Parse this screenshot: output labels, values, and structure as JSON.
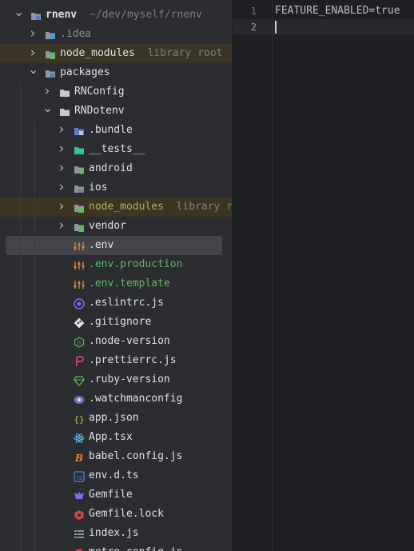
{
  "project": {
    "name": "rnenv",
    "path": "~/dev/myself/rnenv"
  },
  "tree": [
    {
      "label": "rnenv",
      "hint": "~/dev/myself/rnenv",
      "icon": "module-folder-icon",
      "chevron": "down",
      "color": "#dfe1e5"
    },
    {
      "label": ".idea",
      "hint": "",
      "icon": "idea-folder-icon",
      "chevron": "right",
      "color": "#8c8f95"
    },
    {
      "label": "node_modules",
      "hint": "library root",
      "icon": "node-modules-folder-icon",
      "chevron": "right",
      "color": "#dfe1e5"
    },
    {
      "label": "packages",
      "hint": "",
      "icon": "module-folder-icon",
      "chevron": "down",
      "color": "#dfe1e5"
    },
    {
      "label": "RNConfig",
      "hint": "",
      "icon": "folder-icon",
      "chevron": "right",
      "color": "#dfe1e5"
    },
    {
      "label": "RNDotenv",
      "hint": "",
      "icon": "folder-icon",
      "chevron": "down",
      "color": "#dfe1e5"
    },
    {
      "label": ".bundle",
      "hint": "",
      "icon": "config-folder-icon",
      "chevron": "right",
      "color": "#dfe1e5"
    },
    {
      "label": "__tests__",
      "hint": "",
      "icon": "tests-folder-icon",
      "chevron": "right",
      "color": "#dfe1e5"
    },
    {
      "label": "android",
      "hint": "",
      "icon": "android-folder-icon",
      "chevron": "right",
      "color": "#dfe1e5"
    },
    {
      "label": "ios",
      "hint": "",
      "icon": "ios-folder-icon",
      "chevron": "right",
      "color": "#dfe1e5"
    },
    {
      "label": "node_modules",
      "hint": "library roo",
      "icon": "node-modules-folder-icon",
      "chevron": "right",
      "color": "#b3ae60"
    },
    {
      "label": "vendor",
      "hint": "",
      "icon": "vendor-folder-icon",
      "chevron": "right",
      "color": "#dfe1e5"
    },
    {
      "label": ".env",
      "hint": "",
      "icon": "env-file-icon",
      "chevron": "",
      "color": "#dfe1e5"
    },
    {
      "label": ".env.production",
      "hint": "",
      "icon": "env-file-icon",
      "chevron": "",
      "color": "#5fb863"
    },
    {
      "label": ".env.template",
      "hint": "",
      "icon": "env-file-icon",
      "chevron": "",
      "color": "#5fb863"
    },
    {
      "label": ".eslintrc.js",
      "hint": "",
      "icon": "eslint-icon",
      "chevron": "",
      "color": "#dfe1e5"
    },
    {
      "label": ".gitignore",
      "hint": "",
      "icon": "git-icon",
      "chevron": "",
      "color": "#dfe1e5"
    },
    {
      "label": ".node-version",
      "hint": "",
      "icon": "nodejs-icon",
      "chevron": "",
      "color": "#dfe1e5"
    },
    {
      "label": ".prettierrc.js",
      "hint": "",
      "icon": "prettier-icon",
      "chevron": "",
      "color": "#dfe1e5"
    },
    {
      "label": ".ruby-version",
      "hint": "",
      "icon": "ruby-icon",
      "chevron": "",
      "color": "#dfe1e5"
    },
    {
      "label": ".watchmanconfig",
      "hint": "",
      "icon": "watchman-icon",
      "chevron": "",
      "color": "#dfe1e5"
    },
    {
      "label": "app.json",
      "hint": "",
      "icon": "json-icon",
      "chevron": "",
      "color": "#dfe1e5"
    },
    {
      "label": "App.tsx",
      "hint": "",
      "icon": "react-icon",
      "chevron": "",
      "color": "#dfe1e5"
    },
    {
      "label": "babel.config.js",
      "hint": "",
      "icon": "babel-icon",
      "chevron": "",
      "color": "#dfe1e5"
    },
    {
      "label": "env.d.ts",
      "hint": "",
      "icon": "typescript-icon",
      "chevron": "",
      "color": "#dfe1e5"
    },
    {
      "label": "Gemfile",
      "hint": "",
      "icon": "gemfile-icon",
      "chevron": "",
      "color": "#dfe1e5"
    },
    {
      "label": "Gemfile.lock",
      "hint": "",
      "icon": "gemfile-lock-icon",
      "chevron": "",
      "color": "#dfe1e5"
    },
    {
      "label": "index.js",
      "hint": "",
      "icon": "js-index-icon",
      "chevron": "",
      "color": "#dfe1e5"
    },
    {
      "label": "metro.config.js",
      "hint": "",
      "icon": "metro-icon",
      "chevron": "",
      "color": "#dfe1e5"
    }
  ],
  "selected_label": ".env",
  "editor": {
    "lines": [
      {
        "num": "1",
        "text": "FEATURE_ENABLED=true"
      },
      {
        "num": "2",
        "text": ""
      }
    ],
    "current_line": "2"
  }
}
